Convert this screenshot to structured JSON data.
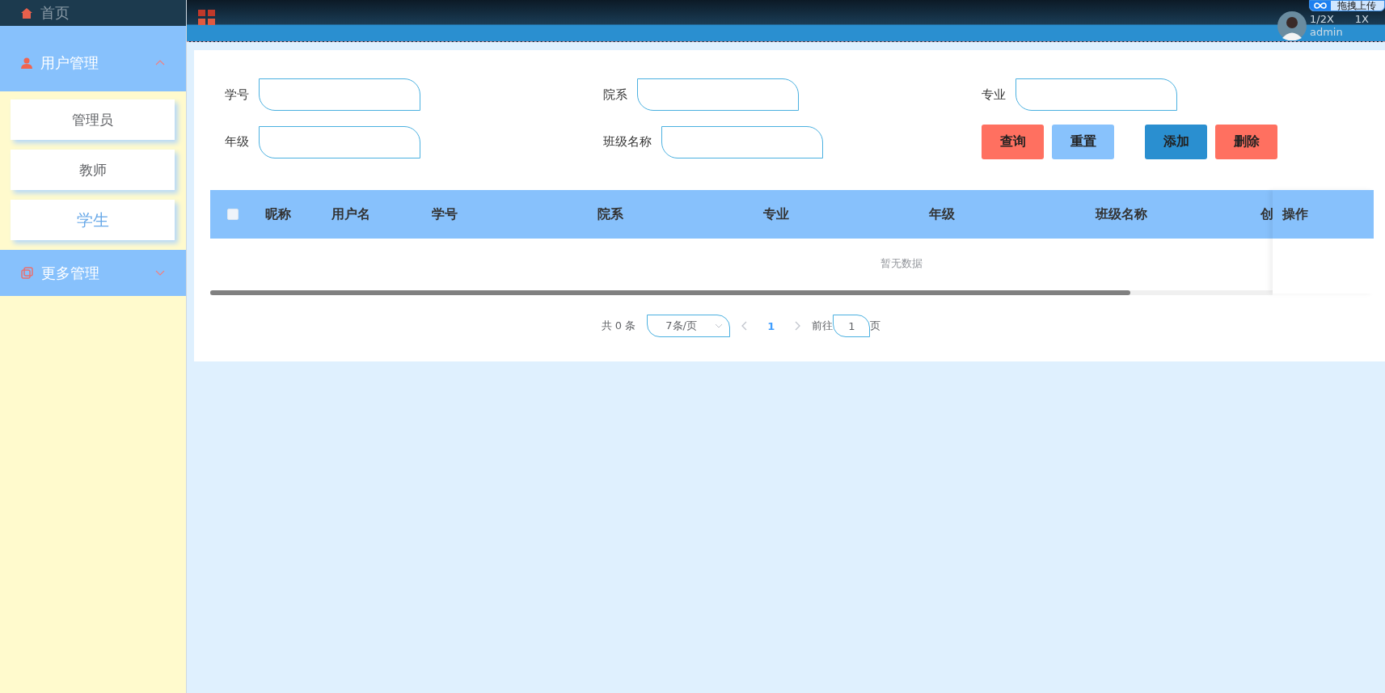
{
  "sidebar": {
    "items": [
      {
        "label": "首页",
        "kind": "home",
        "expanded": false
      },
      {
        "label": "用户管理",
        "kind": "user",
        "expanded": true,
        "children": [
          {
            "label": "管理员",
            "selected": false
          },
          {
            "label": "教师",
            "selected": false
          },
          {
            "label": "学生",
            "selected": true
          }
        ]
      },
      {
        "label": "更多管理",
        "kind": "copy",
        "expanded": false
      }
    ]
  },
  "header": {
    "upload_badge": "拖拽上传",
    "zoom_labels": [
      "1/2X",
      "1X"
    ],
    "user": "admin"
  },
  "filters": [
    {
      "label": "学号"
    },
    {
      "label": "院系"
    },
    {
      "label": "专业"
    },
    {
      "label": "年级"
    },
    {
      "label": "班级名称"
    }
  ],
  "buttons": [
    {
      "label": "查询",
      "kind": "danger"
    },
    {
      "label": "重置",
      "kind": "light"
    },
    {
      "label": "添加",
      "kind": "primary"
    },
    {
      "label": "删除",
      "kind": "danger"
    }
  ],
  "table": {
    "select_all": {
      "checked": false
    },
    "columns": [
      "昵称",
      "用户名",
      "学号",
      "院系",
      "专业",
      "年级",
      "班级名称",
      "创"
    ],
    "fixed_column": "操作",
    "empty_text": "暂无数据"
  },
  "pagination": {
    "total": "共 0 条",
    "page_size": "7条/页",
    "pages": [
      {
        "label": "1",
        "selected": true
      }
    ],
    "goto_label": "前往",
    "goto_value": "1",
    "goto_suffix": "页"
  }
}
